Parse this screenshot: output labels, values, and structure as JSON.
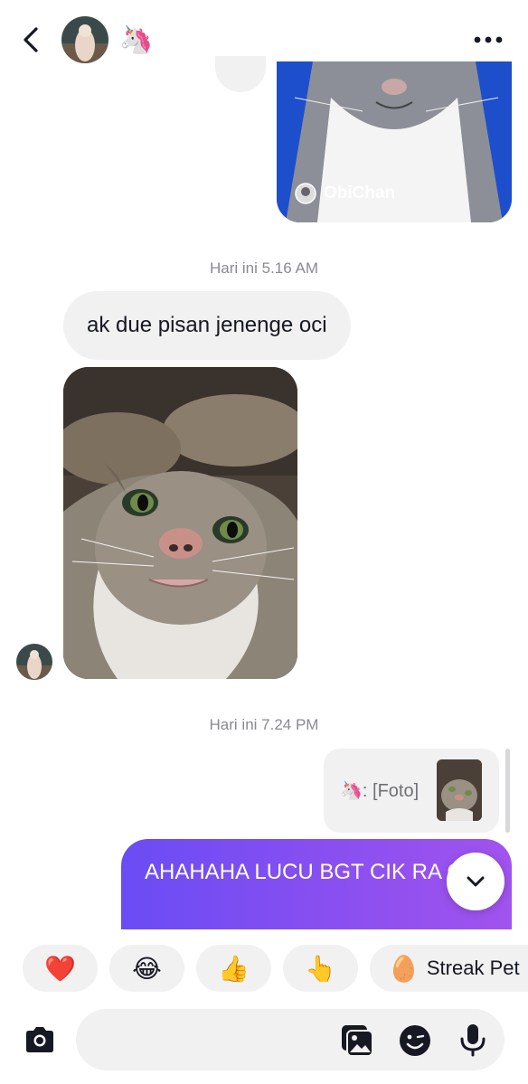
{
  "header": {
    "name_emoji": "🦄"
  },
  "shared_post": {
    "username": "ObiChan"
  },
  "messages": {
    "timestamp_1": "Hari ini 5.16 AM",
    "incoming_text": "ak due pisan jenenge oci",
    "timestamp_2": "Hari ini 7.24 PM",
    "reply_quote": "🦄: [Foto]",
    "outgoing_text": "AHAHAHA LUCU BGT CIK RA OCI"
  },
  "quick_reactions": [
    {
      "emoji": "❤️"
    },
    {
      "emoji": "😂"
    },
    {
      "emoji": "👍"
    },
    {
      "emoji": "👆"
    },
    {
      "emoji": "🥚",
      "label": "Streak Pet"
    }
  ],
  "composer": {
    "placeholder": ""
  },
  "icons": {
    "back": "chevron-left-icon",
    "more": "more-horizontal-icon",
    "scroll_down": "chevron-down-icon",
    "camera": "camera-icon",
    "gallery": "gallery-icon",
    "emoji": "emoji-icon",
    "mic": "microphone-icon"
  },
  "colors": {
    "bubble_gradient_start": "#6a4cf5",
    "bubble_gradient_end": "#a153ee",
    "incoming_bubble": "#f1f1f2",
    "timestamp": "#8a8b91"
  }
}
